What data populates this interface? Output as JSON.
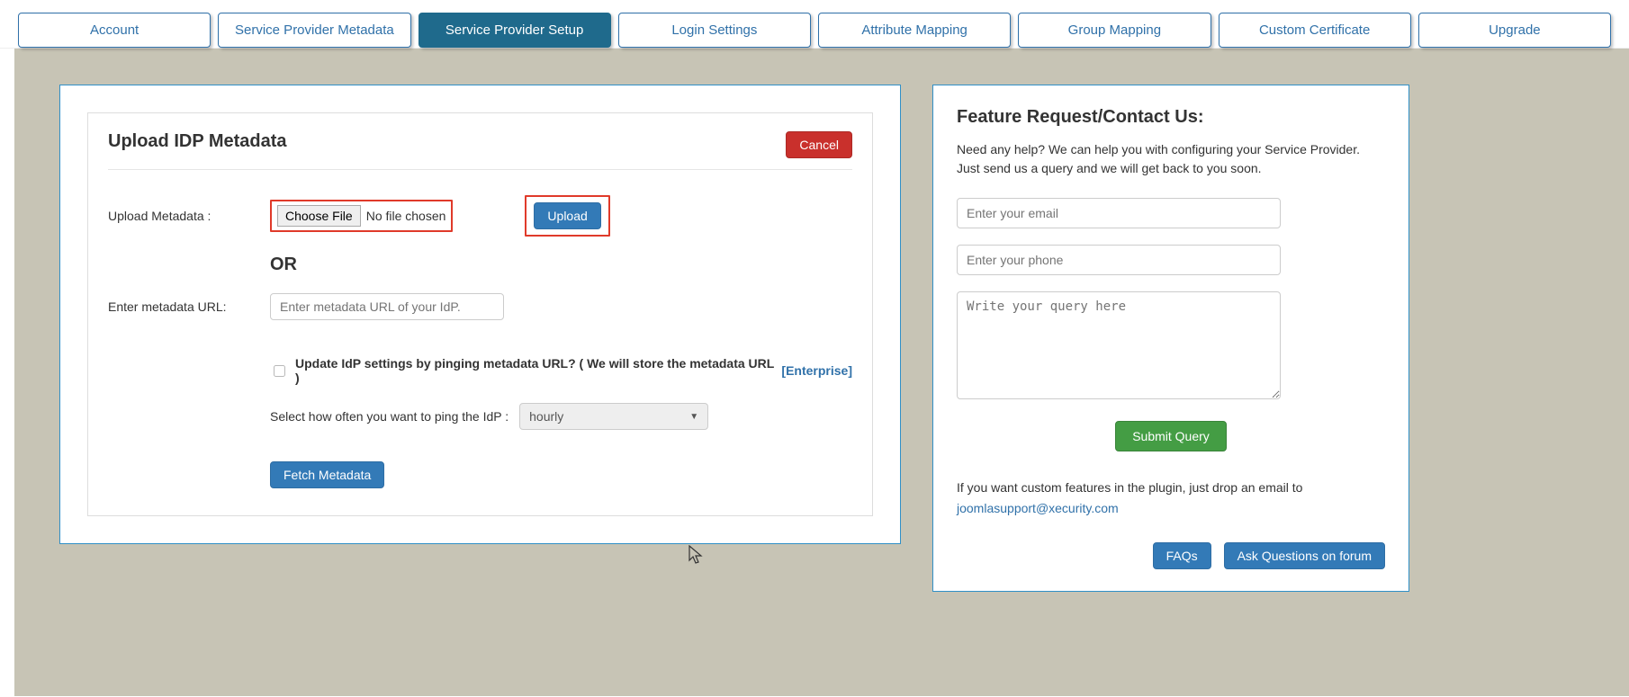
{
  "tabs": {
    "account": "Account",
    "sp_metadata": "Service Provider Metadata",
    "sp_setup": "Service Provider Setup",
    "login_settings": "Login Settings",
    "attribute_mapping": "Attribute Mapping",
    "group_mapping": "Group Mapping",
    "custom_certificate": "Custom Certificate",
    "upgrade": "Upgrade"
  },
  "main": {
    "title": "Upload IDP Metadata",
    "cancel": "Cancel",
    "upload_metadata_label": "Upload Metadata :",
    "choose_file": "Choose File",
    "no_file": "No file chosen",
    "upload_btn": "Upload",
    "or": "OR",
    "enter_url_label": "Enter metadata URL:",
    "url_placeholder": "Enter metadata URL of your IdP.",
    "update_text": "Update IdP settings by pinging metadata URL? ( We will store the metadata URL )",
    "enterprise": "[Enterprise]",
    "ping_label": "Select how often you want to ping the IdP :",
    "ping_value": "hourly",
    "fetch_btn": "Fetch Metadata"
  },
  "side": {
    "title": "Feature Request/Contact Us:",
    "desc": "Need any help? We can help you with configuring your Service Provider. Just send us a query and we will get back to you soon.",
    "email_placeholder": "Enter your email",
    "phone_placeholder": "Enter your phone",
    "query_placeholder": "Write your query here",
    "submit": "Submit Query",
    "note": "If you want custom features in the plugin, just drop an email to",
    "support_email": "joomlasupport@xecurity.com",
    "faqs": "FAQs",
    "ask_forum": "Ask Questions on forum"
  }
}
